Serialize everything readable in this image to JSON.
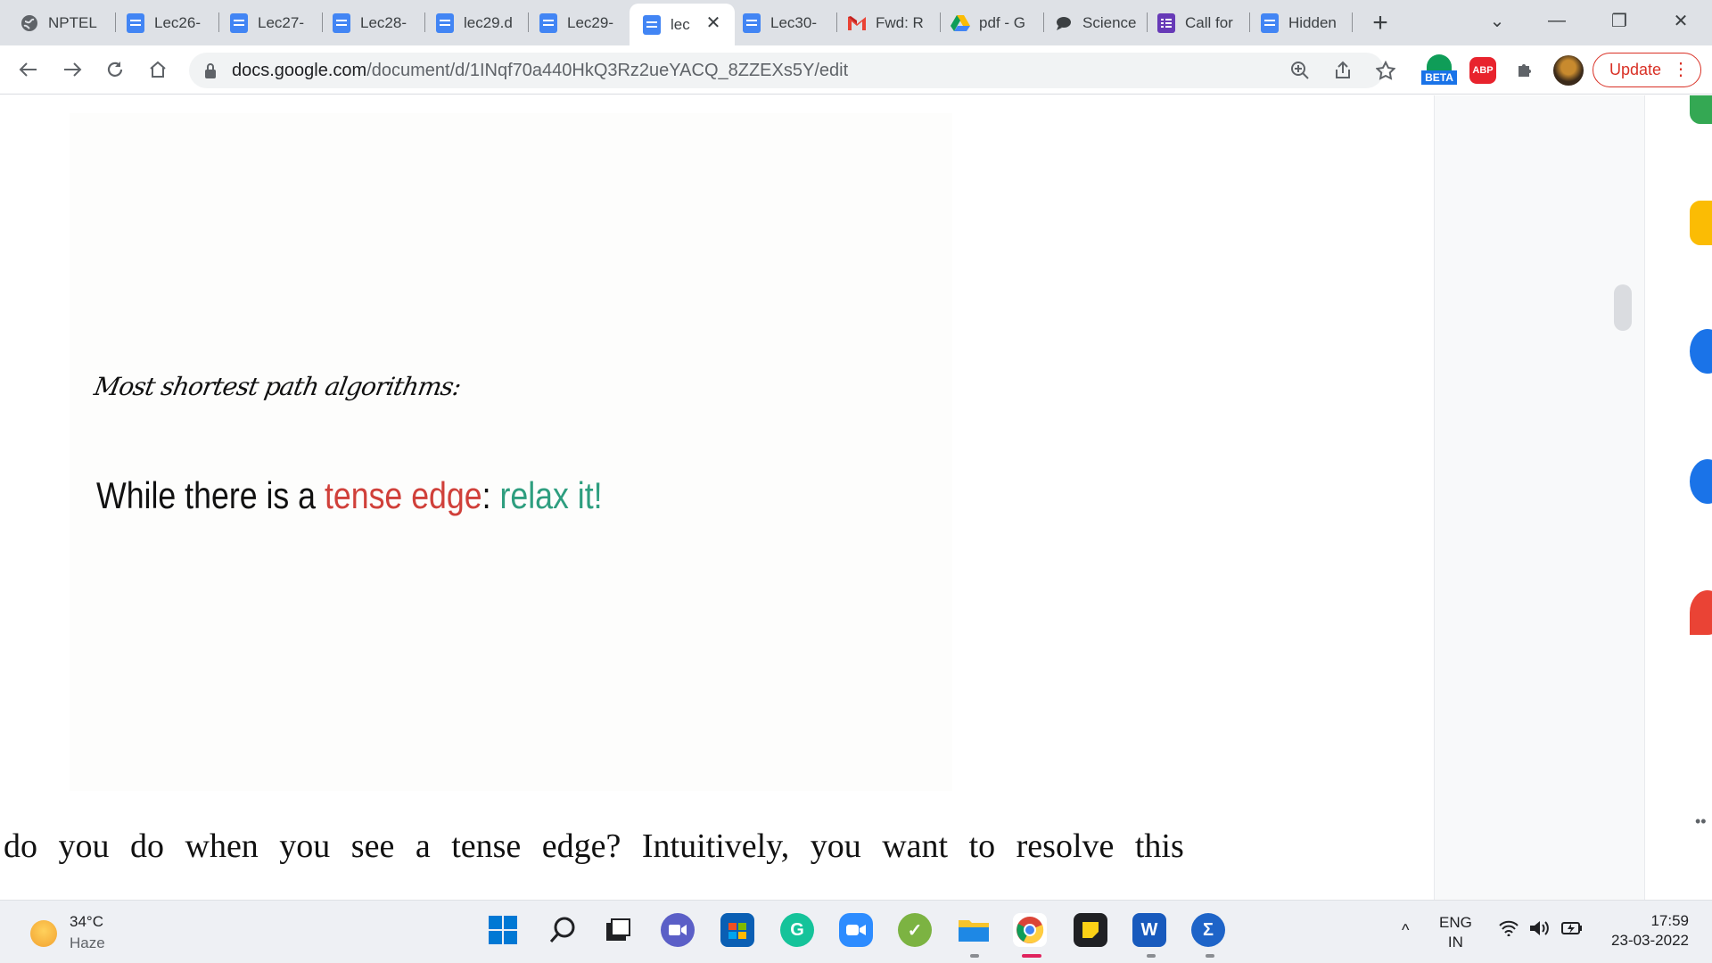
{
  "browser": {
    "tabs": [
      {
        "label": "NPTEL",
        "icon": "globe-icon"
      },
      {
        "label": "Lec26-",
        "icon": "docs-icon"
      },
      {
        "label": "Lec27-",
        "icon": "docs-icon"
      },
      {
        "label": "Lec28-",
        "icon": "docs-icon"
      },
      {
        "label": "lec29.d",
        "icon": "docs-icon"
      },
      {
        "label": "Lec29-",
        "icon": "docs-icon"
      },
      {
        "label": "lec",
        "icon": "docs-icon",
        "active": true
      },
      {
        "label": "Lec30-",
        "icon": "docs-icon"
      },
      {
        "label": "Fwd: R",
        "icon": "gmail-icon"
      },
      {
        "label": "pdf - G",
        "icon": "drive-icon"
      },
      {
        "label": "Science",
        "icon": "chat-icon"
      },
      {
        "label": "Call for",
        "icon": "forms-icon"
      },
      {
        "label": "Hidden",
        "icon": "docs-icon"
      }
    ],
    "new_tab_label": "+",
    "close_tab_label": "✕",
    "window_controls": {
      "list": "⌄",
      "minimize": "—",
      "restore": "❐",
      "close": "✕"
    },
    "url_domain": "docs.google.com",
    "url_path": "/document/d/1INqf70a440HkQ3Rz2ueYACQ_8ZZEXs5Y/edit",
    "extension_beta_label": "BETA",
    "extension_abp_label": "ABP",
    "update_label": "Update",
    "update_menu": "⋮"
  },
  "document": {
    "slide_handwritten": "Most shortest path algorithms:",
    "slide_line_1": "While there is a ",
    "slide_line_red": "tense edge",
    "slide_line_2": ": ",
    "slide_line_green": "relax it!",
    "body_text": "do you do when you see a tense edge? Intuitively, you want to resolve this"
  },
  "taskbar": {
    "weather_temp": "34°C",
    "weather_condition": "Haze",
    "language_line1": "ENG",
    "language_line2": "IN",
    "time": "17:59",
    "date": "23-03-2022"
  },
  "colors": {
    "accent_red": "#d0403a",
    "accent_green": "#2e9e7f",
    "docs_blue": "#4285f4",
    "update_red": "#d93025"
  }
}
